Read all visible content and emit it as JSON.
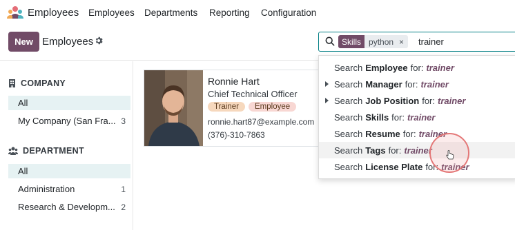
{
  "navbar": {
    "app_name": "Employees",
    "menu": [
      "Employees",
      "Departments",
      "Reporting",
      "Configuration"
    ]
  },
  "control": {
    "new_label": "New",
    "breadcrumb": "Employees"
  },
  "search": {
    "facet_label": "Skills",
    "facet_value": "python",
    "facet_remove": "×",
    "text": "trainer"
  },
  "search_dropdown": {
    "prefix": "Search",
    "suffix": "for:",
    "query": "trainer",
    "items": [
      {
        "field": "Employee",
        "expandable": false
      },
      {
        "field": "Manager",
        "expandable": true
      },
      {
        "field": "Job Position",
        "expandable": true
      },
      {
        "field": "Skills",
        "expandable": false
      },
      {
        "field": "Resume",
        "expandable": false
      },
      {
        "field": "Tags",
        "expandable": false
      },
      {
        "field": "License Plate",
        "expandable": false
      }
    ],
    "highlighted_index": 5
  },
  "sidepanel": {
    "company": {
      "heading": "COMPANY",
      "items": [
        {
          "label": "All",
          "count": ""
        },
        {
          "label": "My Company (San Fra...",
          "count": "3"
        }
      ]
    },
    "department": {
      "heading": "DEPARTMENT",
      "items": [
        {
          "label": "All",
          "count": ""
        },
        {
          "label": "Administration",
          "count": "1"
        },
        {
          "label": "Research & Developm...",
          "count": "2"
        }
      ]
    }
  },
  "employee_card": {
    "name": "Ronnie Hart",
    "job": "Chief Technical Officer",
    "tags": [
      "Trainer",
      "Employee"
    ],
    "email": "ronnie.hart87@example.com",
    "phone": "(376)-310-7863"
  },
  "colors": {
    "brand": "#714b67",
    "accent": "#017e84",
    "active_bg": "#e6f2f3"
  }
}
